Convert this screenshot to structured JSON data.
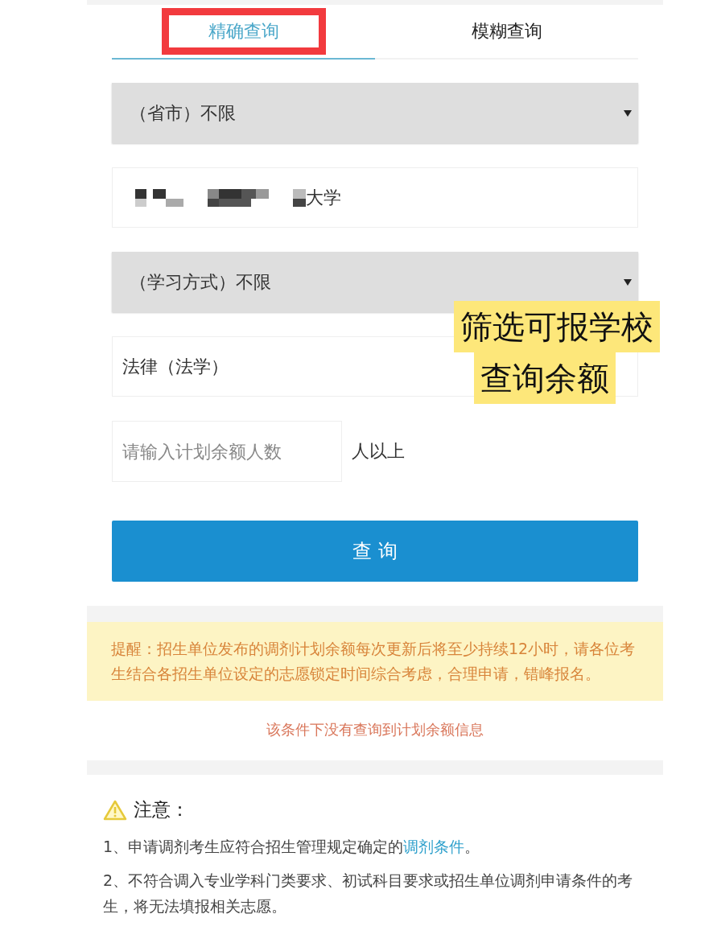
{
  "tabs": [
    {
      "label": "精确查询",
      "selected": true,
      "highlighted": true
    },
    {
      "label": "模糊查询",
      "selected": false,
      "highlighted": false
    }
  ],
  "form": [
    {
      "kind": "select",
      "value": "（省市）不限"
    },
    {
      "kind": "text",
      "value": "大学",
      "redacted": true
    },
    {
      "kind": "select",
      "value": "（学习方式）不限"
    },
    {
      "kind": "text",
      "value": "法律（法学）"
    }
  ],
  "quota": {
    "placeholder": "请输入计划余额人数",
    "suffix": "人以上"
  },
  "query_button": "查 询",
  "captions": [
    "筛选可报学校",
    "查询余额"
  ],
  "reminder": "提醒：招生单位发布的调剂计划余额每次更新后将至少持续12小时，请各位考生结合各招生单位设定的志愿锁定时间综合考虑，合理申请，错峰报名。",
  "empty_message": "该条件下没有查询到计划余额信息",
  "notice": {
    "title": "注意：",
    "items": [
      {
        "text": "1、申请调剂考生应符合招生管理规定确定的",
        "link": "调剂条件",
        "after": "。"
      },
      {
        "text": "2、不符合调入专业学科门类要求、初试科目要求或招生单位调剂申请条件的考生，将无法填报相关志愿。"
      }
    ]
  }
}
